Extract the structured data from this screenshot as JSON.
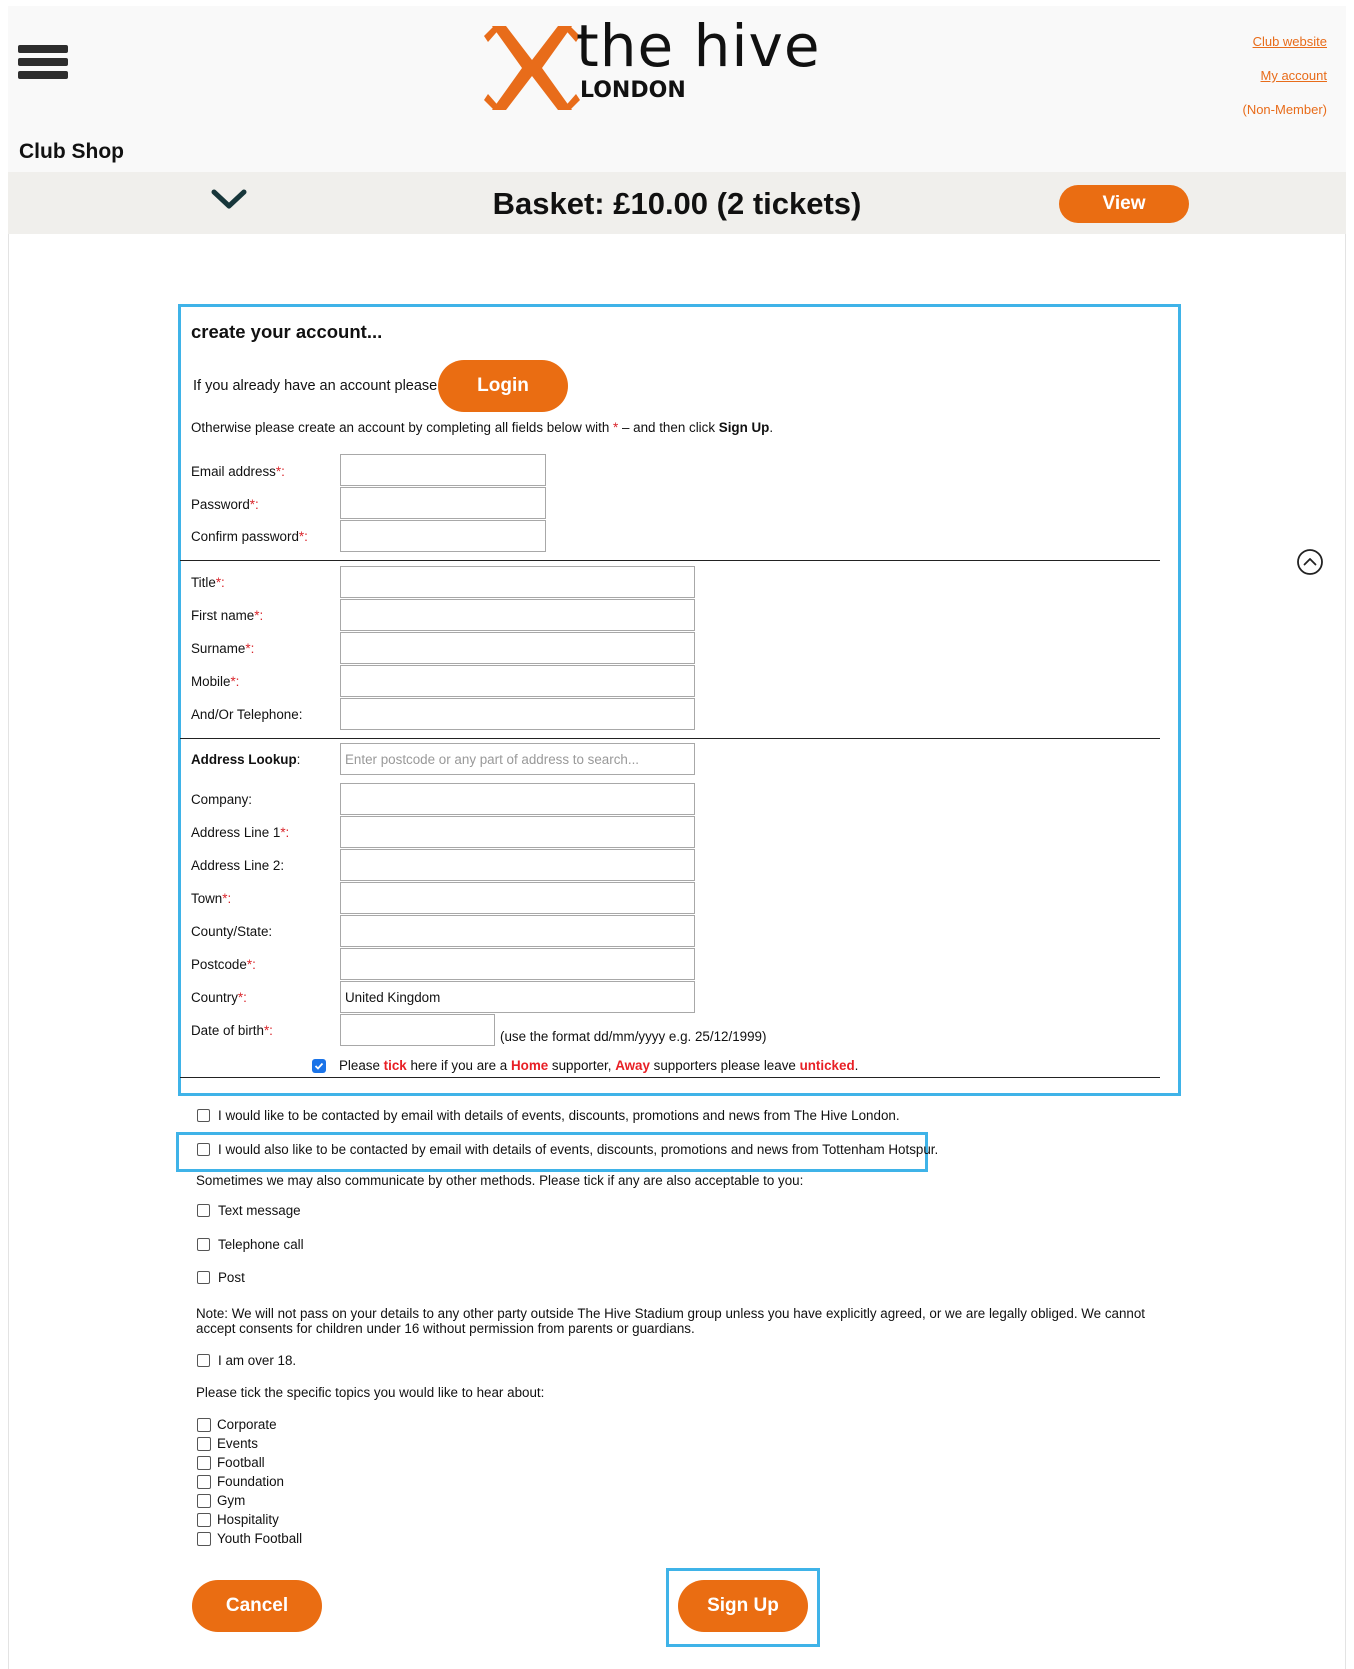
{
  "header": {
    "logo_main": "the hive",
    "logo_sub": "LONDON",
    "club_shop": "Club Shop",
    "links": {
      "club_website": "Club website",
      "my_account": "My account",
      "member_status": "(Non-Member)"
    },
    "brand_color": "#E86C1A"
  },
  "basket": {
    "summary": "Basket: £10.00 (2 tickets)",
    "view_label": "View"
  },
  "form": {
    "heading": "create your account...",
    "already_text": "If you already have an account please",
    "login_label": "Login",
    "otherwise_pre": "Otherwise please create an account by completing all fields below with",
    "otherwise_mid": " – and then click ",
    "otherwise_signup": "Sign Up",
    "otherwise_end": ".",
    "required_mark": "*",
    "colon": ":",
    "fields": {
      "email": "Email address",
      "password": "Password",
      "confirm_password": "Confirm password",
      "title": "Title",
      "first_name": "First name",
      "surname": "Surname",
      "mobile": "Mobile",
      "telephone": "And/Or Telephone:",
      "address_lookup": "Address Lookup",
      "address_lookup_placeholder": "Enter postcode or any part of address to search...",
      "company": "Company:",
      "address1": "Address Line 1",
      "address2": "Address Line 2:",
      "town": "Town",
      "county": "County/State:",
      "postcode": "Postcode",
      "country": "Country",
      "country_value": "United Kingdom",
      "dob": "Date of birth",
      "dob_hint": "(use the format dd/mm/yyyy e.g. 25/12/1999)"
    },
    "home_supporter": {
      "checked": true,
      "p1": "Please ",
      "tick": "tick",
      "p2": " here if you are a ",
      "home": "Home",
      "p3": " supporter, ",
      "away": "Away",
      "p4": " supporters please leave ",
      "unticked": "unticked",
      "p5": "."
    }
  },
  "consent": {
    "hive_email": "I would like to be contacted by email with details of events, discounts, promotions and news from The Hive London.",
    "spurs_email": "I would also like to be contacted by email with details of events, discounts, promotions and news from Tottenham Hotspur.",
    "other_methods": "Sometimes we may also communicate by other methods. Please tick if any are also acceptable to you:",
    "text_message": "Text message",
    "telephone_call": "Telephone call",
    "post": "Post",
    "note": "Note: We will not pass on your details to any other party outside The Hive Stadium group unless you have explicitly agreed, or we are legally obliged. We cannot accept consents for children under 16 without permission from parents or guardians.",
    "over_18": "I am over 18.",
    "topics_intro": "Please tick the specific topics you would like to hear about:",
    "topics": [
      "Corporate",
      "Events",
      "Football",
      "Foundation",
      "Gym",
      "Hospitality",
      "Youth Football"
    ]
  },
  "actions": {
    "cancel_label": "Cancel",
    "signup_label": "Sign Up"
  },
  "highlight_color": "#3FB3E8"
}
